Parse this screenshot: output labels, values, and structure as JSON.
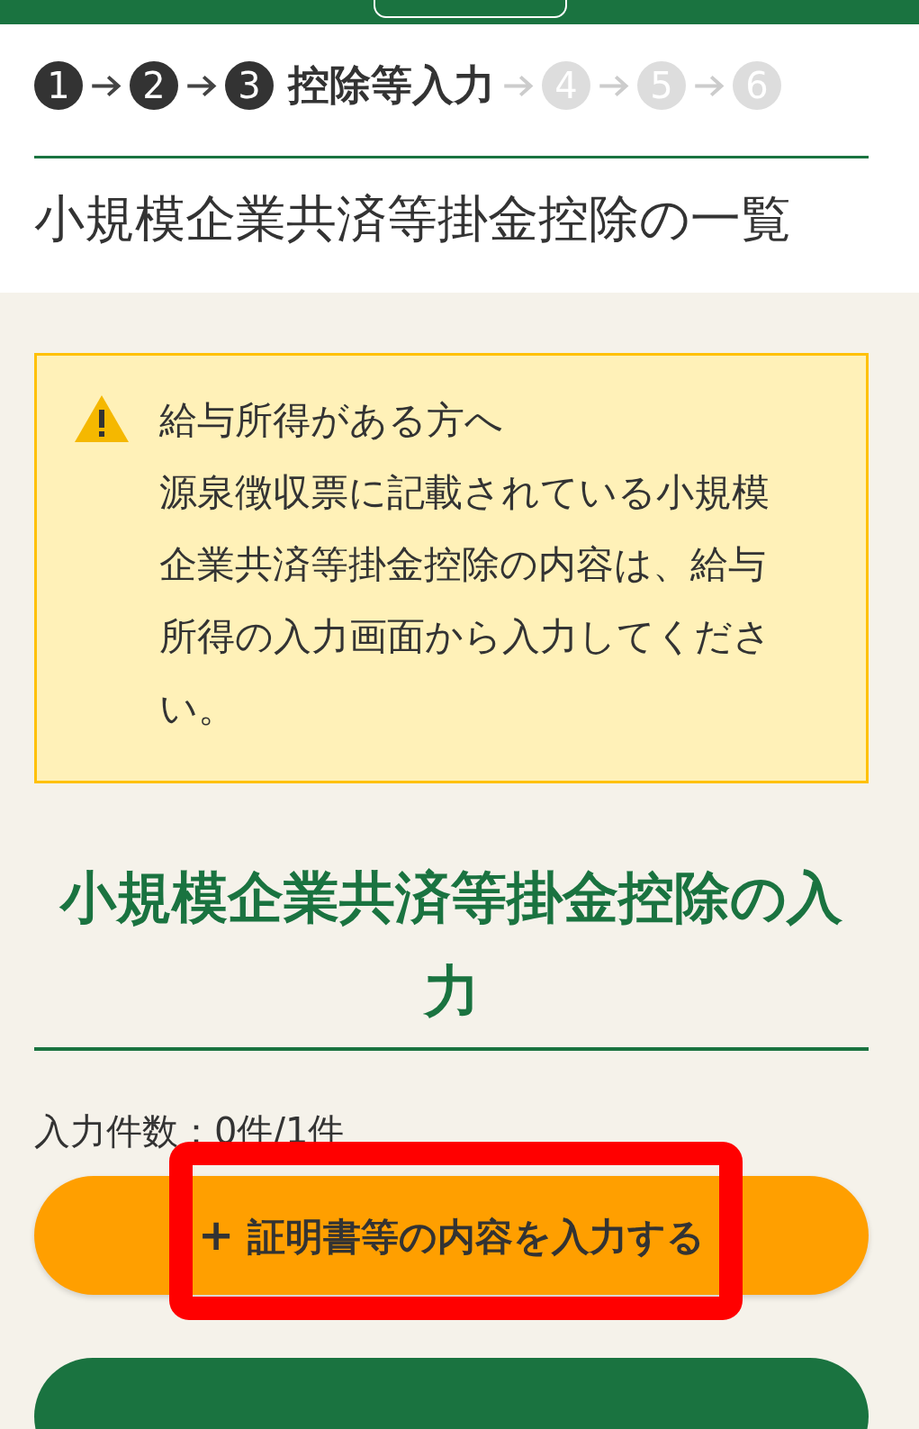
{
  "steps": [
    {
      "number": "1",
      "active": true
    },
    {
      "number": "2",
      "active": true
    },
    {
      "number": "3",
      "active": true,
      "label": "控除等入力"
    },
    {
      "number": "4",
      "active": false
    },
    {
      "number": "5",
      "active": false
    },
    {
      "number": "6",
      "active": false
    }
  ],
  "page_title": "小規模企業共済等掛金控除の一覧",
  "notice": {
    "heading": "給与所得がある方へ",
    "text": "源泉徴収票に記載されている小規模企業共済等掛金控除の内容は、給与所得の入力画面から入力してください。"
  },
  "section_heading": "小規模企業共済等掛金控除の入力",
  "count_text": "入力件数：0件/1件",
  "add_button": {
    "icon": "+",
    "label": "証明書等の内容を入力する",
    "highlighted": true
  }
}
